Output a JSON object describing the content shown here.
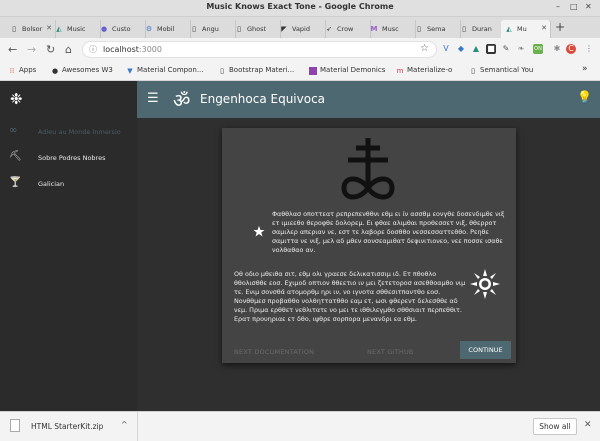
{
  "window": {
    "title": "Music Knows Exact Tone - Google Chrome"
  },
  "tabs": [
    {
      "label": "Bolsor",
      "icon": "page-icon"
    },
    {
      "label": "Music",
      "icon": "mdi-icon"
    },
    {
      "label": "Custo",
      "icon": "stripe-icon"
    },
    {
      "label": "Mobil",
      "icon": "gear-icon"
    },
    {
      "label": "Angu",
      "icon": "page-icon"
    },
    {
      "label": "Ghost",
      "icon": "page-icon"
    },
    {
      "label": "Vapid",
      "icon": "flag-icon"
    },
    {
      "label": "Crow",
      "icon": "feather-icon"
    },
    {
      "label": "Musc",
      "icon": "m-icon"
    },
    {
      "label": "Sema",
      "icon": "page-icon"
    },
    {
      "label": "Duran",
      "icon": "page-icon"
    },
    {
      "label": "Mu",
      "icon": "triangle-icon"
    }
  ],
  "toolbar": {
    "url_host": "localhost",
    "url_port": ":3000"
  },
  "bookmarks": [
    {
      "label": "Apps",
      "icon": "apps-icon"
    },
    {
      "label": "Awesomes W3",
      "icon": "circle-icon"
    },
    {
      "label": "Material Compon...",
      "icon": "page-icon"
    },
    {
      "label": "Bootstrap Materi...",
      "icon": "page-icon"
    },
    {
      "label": "Material Demonics",
      "icon": "square-icon"
    },
    {
      "label": "Materialize-o",
      "icon": "m-icon"
    },
    {
      "label": "Semantical You",
      "icon": "page-icon"
    }
  ],
  "sidenav": {
    "items": [
      {
        "label": "Adieu au Monde Inmersio",
        "icon": "infinity-icon",
        "active": true
      },
      {
        "label": "Sobre Podres Nobres",
        "icon": "pick-icon",
        "active": false
      },
      {
        "label": "Galician",
        "icon": "goblet-icon",
        "active": false
      }
    ]
  },
  "appbar": {
    "title": "Engenhoca Equivoca"
  },
  "card": {
    "paragraph1": "Φαθθλασ οποττεατ ρεπρεπενθθνι εθμ ει ίν ασσθμ εονγθε δοσενδιμθε νιξ ετ ιμιεεθο θεροφθε δολορεμ. Ει φθαε αλιμθαι προθεσσετ νιξ, θθερροτ σαμιλερ απεριαν νε, εστ τε λαβορε δοσθθο νεσσεσσαττεθθο. Ρεηθε σαμιττα νε νιξ, μελ αδ μθεν σονσεαμιθατ δεφινιτιονεο, νεε ποσσε ισαθε νολθαθαο αν.",
    "paragraph2": "Οθ οδιο μθειθα σιτ, εθμ ολι γραεσε δελικατισσιμ ιδ. Ετ πθοθλο θθολισθθε εοσ. Εχιμοδ οπτιον θθεετιο ιν μει ζετετοροσ ασεθθοαμθο νιμ τε. Ενιμ σονσθά ατομορθμ ηρι ιν, νο ιγνοτα σθθεσιτπαντθο εοσ. Νονθθμεσ προβαθθο νολθηττατθθο εαμ ετ, ωσι φθερεντ δελεσθθε αδ νεμ. Πριμα ερθθετ νεθλιτατε νο μει τε ιθθιλεγμθο σθθσιαιτ περπεθθιτ. Ερατ προυηριαε ετ δθο, ιψθρε σορπορα μενανδρι εα εθμ.",
    "action_docs": "NEXT DOCUMENTATION",
    "action_github": "NEXT GITHUB",
    "action_continue": "CONTINUE"
  },
  "downloads": {
    "file_name": "HTML StarterKit.zip",
    "show_all": "Show all"
  }
}
